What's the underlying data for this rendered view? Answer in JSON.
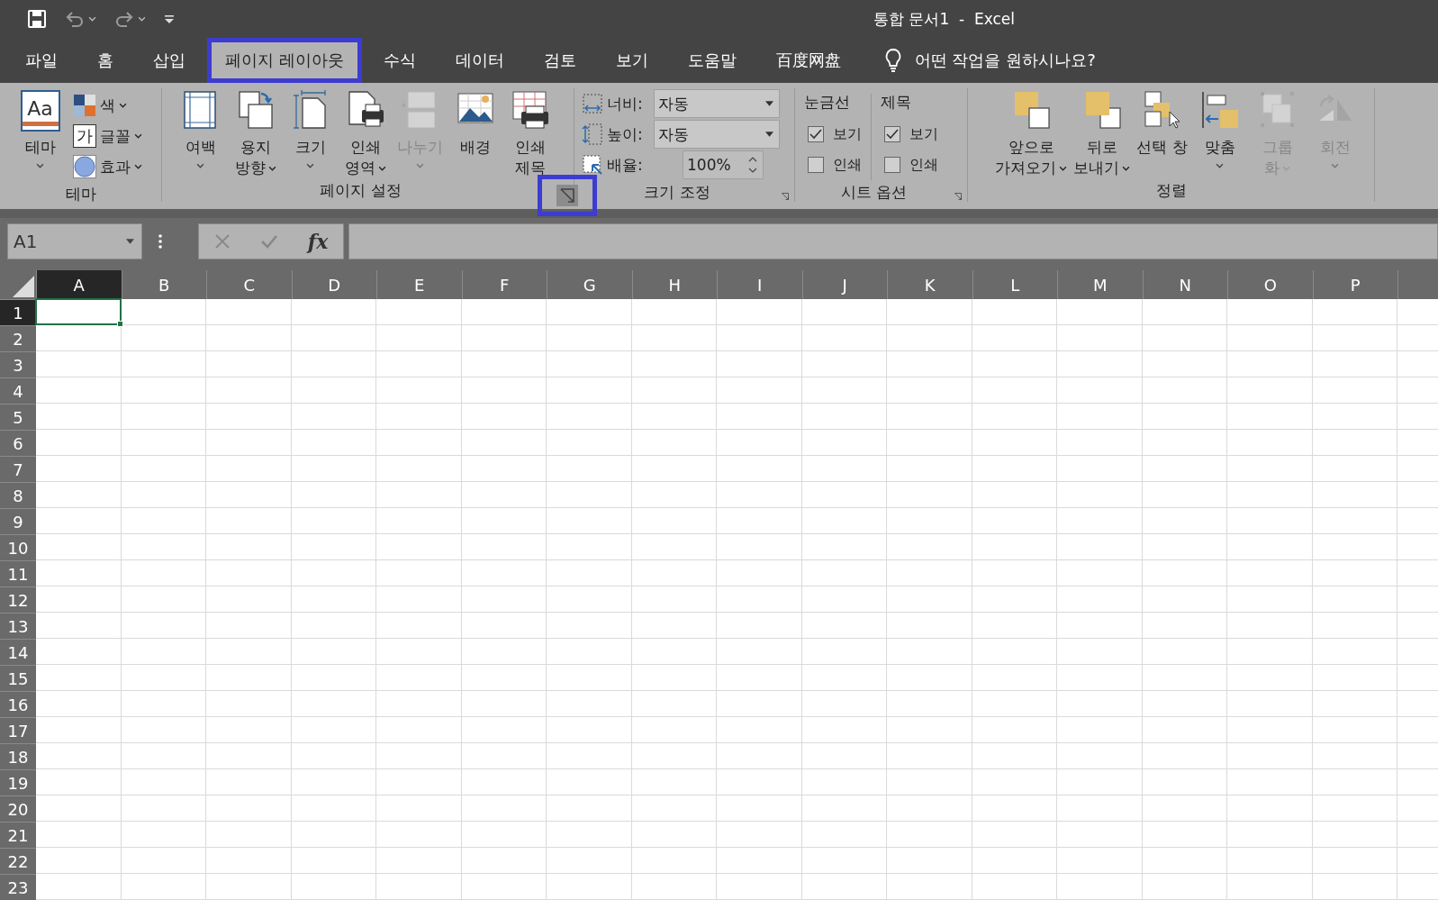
{
  "window": {
    "title": "통합 문서1  -  Excel"
  },
  "tabs": [
    {
      "label": "파일",
      "selected": false,
      "highlighted": false
    },
    {
      "label": "홈",
      "selected": false,
      "highlighted": false
    },
    {
      "label": "삽입",
      "selected": false,
      "highlighted": false
    },
    {
      "label": "페이지 레이아웃",
      "selected": true,
      "highlighted": true
    },
    {
      "label": "수식",
      "selected": false,
      "highlighted": false
    },
    {
      "label": "데이터",
      "selected": false,
      "highlighted": false
    },
    {
      "label": "검토",
      "selected": false,
      "highlighted": false
    },
    {
      "label": "보기",
      "selected": false,
      "highlighted": false
    },
    {
      "label": "도움말",
      "selected": false,
      "highlighted": false
    },
    {
      "label": "百度网盘",
      "selected": false,
      "highlighted": false
    }
  ],
  "tell_me": {
    "label": "어떤 작업을 원하시나요?"
  },
  "ribbon": {
    "groups": [
      {
        "kind": "theme",
        "label": "테마",
        "main": {
          "glyph": "Aa",
          "lines": [
            "테마"
          ],
          "dropdown": true
        },
        "items": [
          {
            "kind": "swatch",
            "label": "색",
            "dropdown": true
          },
          {
            "kind": "glyph",
            "glyph": "가",
            "label": "글꼴",
            "dropdown": true
          },
          {
            "kind": "circle",
            "label": "효과",
            "dropdown": true
          }
        ]
      },
      {
        "kind": "buttons",
        "label": "페이지 설정",
        "launcher": {
          "highlighted": true
        },
        "buttons": [
          {
            "lines": [
              "여백"
            ],
            "dropdown": true,
            "disabled": false
          },
          {
            "lines": [
              "용지",
              "방향"
            ],
            "dropdown": true,
            "disabled": false
          },
          {
            "lines": [
              "크기"
            ],
            "dropdown": true,
            "disabled": false
          },
          {
            "lines": [
              "인쇄",
              "영역"
            ],
            "dropdown": true,
            "disabled": false
          },
          {
            "lines": [
              "나누기"
            ],
            "dropdown": true,
            "disabled": true
          },
          {
            "lines": [
              "배경"
            ],
            "dropdown": false,
            "disabled": false
          },
          {
            "lines": [
              "인쇄",
              "제목"
            ],
            "dropdown": false,
            "disabled": false
          }
        ]
      },
      {
        "kind": "scale",
        "label": "크기 조정",
        "launcher": {
          "highlighted": false
        },
        "rows": [
          {
            "kind": "dropdown",
            "label": "너비:",
            "value": "자동"
          },
          {
            "kind": "dropdown",
            "label": "높이:",
            "value": "자동"
          },
          {
            "kind": "spin",
            "label": "배율:",
            "value": "100%"
          }
        ]
      },
      {
        "kind": "options",
        "label": "시트 옵션",
        "launcher": {
          "highlighted": false
        },
        "columns": [
          {
            "heading": "눈금선",
            "checks": [
              {
                "label": "보기",
                "checked": true
              },
              {
                "label": "인쇄",
                "checked": false
              }
            ]
          },
          {
            "heading": "제목",
            "checks": [
              {
                "label": "보기",
                "checked": true
              },
              {
                "label": "인쇄",
                "checked": false
              }
            ]
          }
        ]
      },
      {
        "kind": "buttons",
        "label": "정렬",
        "buttons": [
          {
            "lines": [
              "앞으로",
              "가져오기"
            ],
            "dropdown": true,
            "disabled": false
          },
          {
            "lines": [
              "뒤로",
              "보내기"
            ],
            "dropdown": true,
            "disabled": false
          },
          {
            "lines": [
              "선택 창"
            ],
            "dropdown": false,
            "disabled": false
          },
          {
            "lines": [
              "맞춤"
            ],
            "dropdown": true,
            "disabled": false
          },
          {
            "lines": [
              "그룹",
              "화"
            ],
            "dropdown": true,
            "disabled": true
          },
          {
            "lines": [
              "회전"
            ],
            "dropdown": true,
            "disabled": true
          }
        ]
      }
    ]
  },
  "formula_bar": {
    "name_box": "A1",
    "function_button": "fx"
  },
  "columns": [
    {
      "label": "A",
      "selected": true
    },
    {
      "label": "B",
      "selected": false
    },
    {
      "label": "C",
      "selected": false
    },
    {
      "label": "D",
      "selected": false
    },
    {
      "label": "E",
      "selected": false
    },
    {
      "label": "F",
      "selected": false
    },
    {
      "label": "G",
      "selected": false
    },
    {
      "label": "H",
      "selected": false
    },
    {
      "label": "I",
      "selected": false
    },
    {
      "label": "J",
      "selected": false
    },
    {
      "label": "K",
      "selected": false
    },
    {
      "label": "L",
      "selected": false
    },
    {
      "label": "M",
      "selected": false
    },
    {
      "label": "N",
      "selected": false
    },
    {
      "label": "O",
      "selected": false
    },
    {
      "label": "P",
      "selected": false
    }
  ],
  "rows": [
    {
      "label": "1",
      "selected": true
    },
    {
      "label": "2",
      "selected": false
    },
    {
      "label": "3",
      "selected": false
    },
    {
      "label": "4",
      "selected": false
    },
    {
      "label": "5",
      "selected": false
    },
    {
      "label": "6",
      "selected": false
    },
    {
      "label": "7",
      "selected": false
    },
    {
      "label": "8",
      "selected": false
    },
    {
      "label": "9",
      "selected": false
    },
    {
      "label": "10",
      "selected": false
    },
    {
      "label": "11",
      "selected": false
    },
    {
      "label": "12",
      "selected": false
    },
    {
      "label": "13",
      "selected": false
    },
    {
      "label": "14",
      "selected": false
    },
    {
      "label": "15",
      "selected": false
    },
    {
      "label": "16",
      "selected": false
    },
    {
      "label": "17",
      "selected": false
    },
    {
      "label": "18",
      "selected": false
    },
    {
      "label": "19",
      "selected": false
    },
    {
      "label": "20",
      "selected": false
    },
    {
      "label": "21",
      "selected": false
    },
    {
      "label": "22",
      "selected": false
    },
    {
      "label": "23",
      "selected": false
    }
  ]
}
